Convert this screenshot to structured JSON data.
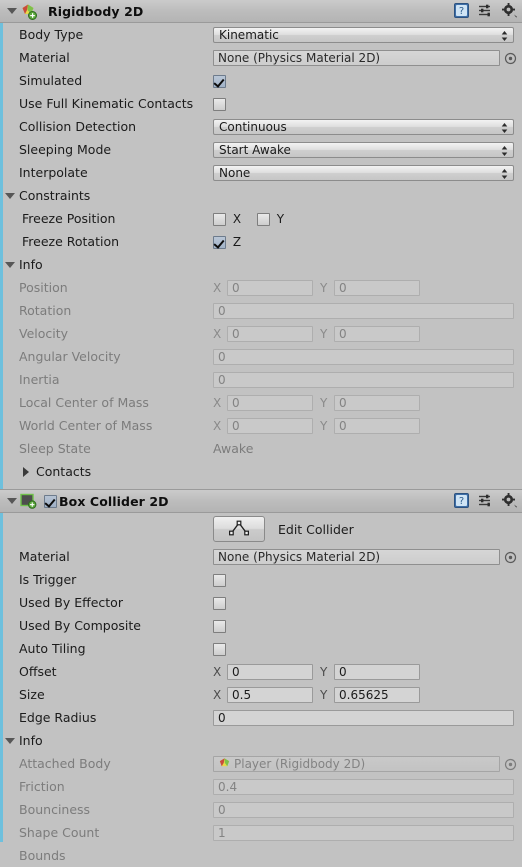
{
  "theme": {
    "panel_bg": "#c2c2c2",
    "header_bg": "#bcbcbc",
    "rail_accent": "#6ec0dd",
    "text": "#1b1b1b",
    "text_disabled": "#7c7c7c"
  },
  "components": [
    {
      "name": "rigidbody2d",
      "title": "Rigidbody 2D",
      "icon": "rigidbody2d-icon",
      "expanded": true,
      "header_icons": [
        "help-icon",
        "preset-icon",
        "gear-icon"
      ],
      "rows": [
        {
          "label": "Body Type",
          "control": "dropdown",
          "value": "Kinematic"
        },
        {
          "label": "Material",
          "control": "object",
          "value": "None (Physics Material 2D)"
        },
        {
          "label": "Simulated",
          "control": "checkbox",
          "checked": true
        },
        {
          "label": "Use Full Kinematic Contacts",
          "control": "checkbox",
          "checked": false,
          "label_wide": true
        },
        {
          "label": "Collision Detection",
          "control": "dropdown",
          "value": "Continuous"
        },
        {
          "label": "Sleeping Mode",
          "control": "dropdown",
          "value": "Start Awake"
        },
        {
          "label": "Interpolate",
          "control": "dropdown",
          "value": "None"
        }
      ],
      "constraints": {
        "label": "Constraints",
        "expanded": true,
        "freeze_position": {
          "label": "Freeze Position",
          "x": {
            "axis": "X",
            "checked": false
          },
          "y": {
            "axis": "Y",
            "checked": false
          }
        },
        "freeze_rotation": {
          "label": "Freeze Rotation",
          "z": {
            "axis": "Z",
            "checked": true
          }
        }
      },
      "info": {
        "label": "Info",
        "expanded": true,
        "rows": [
          {
            "label": "Position",
            "control": "vector2",
            "x": "0",
            "y": "0"
          },
          {
            "label": "Rotation",
            "control": "text",
            "value": "0"
          },
          {
            "label": "Velocity",
            "control": "vector2",
            "x": "0",
            "y": "0"
          },
          {
            "label": "Angular Velocity",
            "control": "text",
            "value": "0"
          },
          {
            "label": "Inertia",
            "control": "text",
            "value": "0"
          },
          {
            "label": "Local Center of Mass",
            "control": "vector2",
            "x": "0",
            "y": "0"
          },
          {
            "label": "World Center of Mass",
            "control": "vector2",
            "x": "0",
            "y": "0"
          },
          {
            "label": "Sleep State",
            "control": "plain",
            "value": "Awake"
          }
        ],
        "contacts": {
          "label": "Contacts",
          "expanded": false
        }
      }
    },
    {
      "name": "boxcollider2d",
      "title": "Box Collider 2D",
      "icon": "boxcollider2d-icon",
      "enabled": true,
      "expanded": true,
      "header_icons": [
        "help-icon",
        "preset-icon",
        "gear-icon"
      ],
      "edit_collider": {
        "button_icon": "edit-collider-icon",
        "label": "Edit Collider"
      },
      "rows": [
        {
          "label": "Material",
          "control": "object",
          "value": "None (Physics Material 2D)"
        },
        {
          "label": "Is Trigger",
          "control": "checkbox",
          "checked": false
        },
        {
          "label": "Used By Effector",
          "control": "checkbox",
          "checked": false
        },
        {
          "label": "Used By Composite",
          "control": "checkbox",
          "checked": false
        },
        {
          "label": "Auto Tiling",
          "control": "checkbox",
          "checked": false
        },
        {
          "label": "Offset",
          "control": "vector2",
          "x": "0",
          "y": "0"
        },
        {
          "label": "Size",
          "control": "vector2",
          "x": "0.5",
          "y": "0.65625"
        },
        {
          "label": "Edge Radius",
          "control": "text",
          "value": "0"
        }
      ],
      "info": {
        "label": "Info",
        "expanded": true,
        "rows": [
          {
            "label": "Attached Body",
            "control": "object_ref",
            "value": "Player (Rigidbody 2D)",
            "icon": "rigidbody2d-icon"
          },
          {
            "label": "Friction",
            "control": "text",
            "value": "0.4"
          },
          {
            "label": "Bounciness",
            "control": "text",
            "value": "0"
          },
          {
            "label": "Shape Count",
            "control": "text",
            "value": "1"
          },
          {
            "label": "Bounds",
            "control": "none",
            "value": ""
          }
        ]
      }
    }
  ]
}
